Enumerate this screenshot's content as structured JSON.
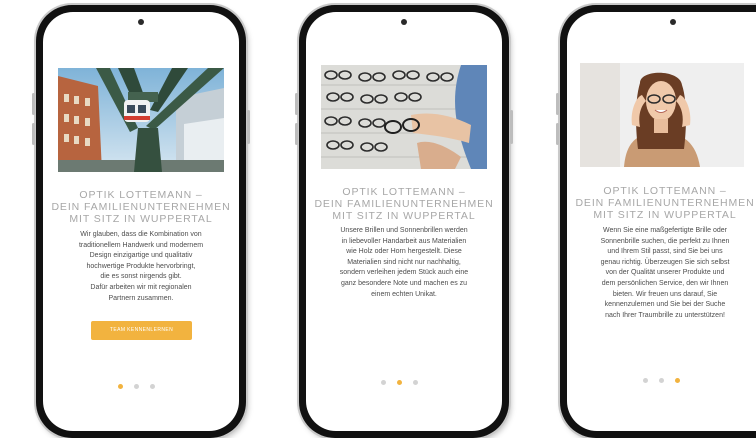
{
  "accent_color": "#f2b33f",
  "slides": [
    {
      "image": "wuppertal-suspension-railway-photo",
      "title_lines": [
        "OPTIK LOTTEMANN –",
        "DEIN FAMILIENUNTERNEHMEN",
        "MIT SITZ IN WUPPERTAL"
      ],
      "body_lines": [
        "Wir glauben, dass die Kombination von",
        "traditionellem Handwerk und modernem",
        "Design einzigartige und qualitativ",
        "hochwertige Produkte hervorbringt,",
        "die es sonst nirgends gibt.",
        "Dafür arbeiten wir mit regionalen",
        "Partnern zusammen."
      ],
      "button_label": "TEAM KENNENLERNEN",
      "active_dot": 0
    },
    {
      "image": "eyewear-display-wall-photo",
      "title_lines": [
        "OPTIK LOTTEMANN –",
        "DEIN FAMILIENUNTERNEHMEN",
        "MIT SITZ IN WUPPERTAL"
      ],
      "body_lines": [
        "Unsere Brillen und Sonnenbrillen werden",
        "in liebevoller Handarbeit aus Materialien",
        "wie Holz oder Horn hergestellt. Diese",
        "Materialien sind nicht nur nachhaltig,",
        "sondern verleihen jedem Stück auch eine",
        "ganz besondere Note und machen es zu",
        "einem echten Unikat."
      ],
      "active_dot": 1
    },
    {
      "image": "woman-trying-glasses-photo",
      "title_lines": [
        "OPTIK LOTTEMANN –",
        "DEIN FAMILIENUNTERNEHMEN",
        "MIT SITZ IN WUPPERTAL"
      ],
      "body_lines": [
        "Wenn Sie eine maßgefertigte Brille oder",
        "Sonnenbrille suchen, die perfekt zu Ihnen",
        "und Ihrem Stil passt, sind Sie bei uns",
        "genau richtig. Überzeugen Sie sich selbst",
        "von der Qualität unserer Produkte und",
        "dem persönlichen Service, den wir Ihnen",
        "bieten.   Wir freuen uns darauf, Sie",
        "kennenzulernen und Sie bei der Suche",
        "nach Ihrer Traumbrille zu unterstützen!"
      ],
      "active_dot": 2
    }
  ]
}
